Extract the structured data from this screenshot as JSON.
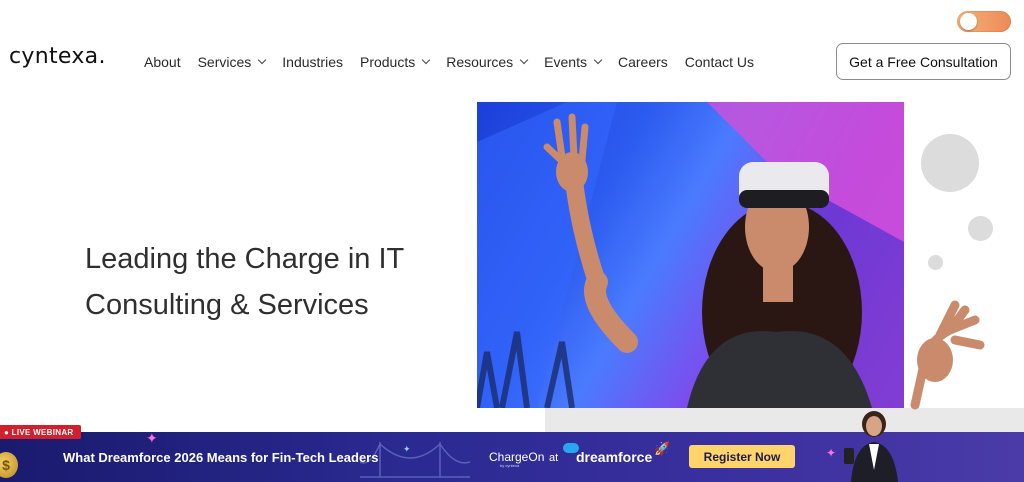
{
  "header": {
    "logo": "cyntexa",
    "logo_dot": ".",
    "nav": [
      {
        "label": "About",
        "dropdown": false
      },
      {
        "label": "Services",
        "dropdown": true
      },
      {
        "label": "Industries",
        "dropdown": false
      },
      {
        "label": "Products",
        "dropdown": true
      },
      {
        "label": "Resources",
        "dropdown": true
      },
      {
        "label": "Events",
        "dropdown": true
      },
      {
        "label": "Careers",
        "dropdown": false
      },
      {
        "label": "Contact Us",
        "dropdown": false
      }
    ],
    "cta_label": "Get a Free Consultation"
  },
  "hero": {
    "title_line1": "Leading the Charge in IT",
    "title_line2": "Consulting & Services"
  },
  "banner": {
    "badge": "● LIVE WEBINAR",
    "title": "What Dreamforce 2026 Means for Fin-Tech Leaders",
    "chargeon": "ChargeOn",
    "chargeon_sub": "by cyntexa",
    "at": "at",
    "dreamforce": "dreamforce",
    "register_label": "Register Now",
    "coin_symbol": "$"
  },
  "colors": {
    "banner_bg": "#2a2a92",
    "register_bg": "#ffd46a",
    "badge_bg": "#d11f2d",
    "toggle": "#ee8a55"
  },
  "icons": {
    "toggle": "theme-toggle",
    "chevron": "chevron-down-icon"
  }
}
